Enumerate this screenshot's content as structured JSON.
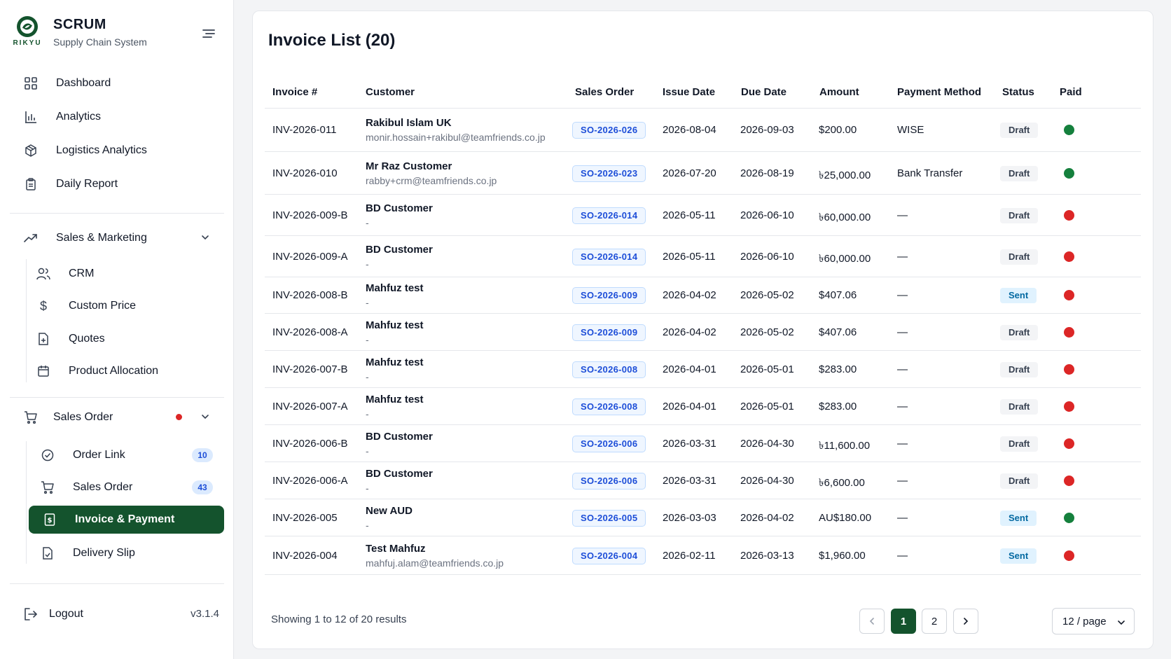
{
  "brand": {
    "logo_text": "RIKYU",
    "title": "SCRUM",
    "subtitle": "Supply Chain System"
  },
  "nav": {
    "dashboard": "Dashboard",
    "analytics": "Analytics",
    "logistics": "Logistics Analytics",
    "daily_report": "Daily Report",
    "sales_marketing": "Sales & Marketing",
    "crm": "CRM",
    "custom_price": "Custom Price",
    "quotes": "Quotes",
    "product_allocation": "Product Allocation",
    "sales_order_group": "Sales Order",
    "order_link": "Order Link",
    "order_link_count": "10",
    "sales_order": "Sales Order",
    "sales_order_count": "43",
    "invoice_payment": "Invoice & Payment",
    "delivery_slip": "Delivery Slip",
    "logout": "Logout",
    "version": "v3.1.4"
  },
  "main": {
    "title": "Invoice List (20)",
    "columns": {
      "invoice": "Invoice #",
      "customer": "Customer",
      "sales_order": "Sales Order",
      "issue_date": "Issue Date",
      "due_date": "Due Date",
      "amount": "Amount",
      "payment_method": "Payment Method",
      "status": "Status",
      "paid": "Paid"
    },
    "rows": [
      {
        "invoice": "INV-2026-011",
        "customer": "Rakibul Islam UK",
        "email": "monir.hossain+rakibul@teamfriends.co.jp",
        "so": "SO-2026-026",
        "issue": "2026-08-04",
        "due": "2026-09-03",
        "amount": "$200.00",
        "method": "WISE",
        "status": "Draft",
        "paid": true
      },
      {
        "invoice": "INV-2026-010",
        "customer": "Mr Raz Customer",
        "email": "rabby+crm@teamfriends.co.jp",
        "so": "SO-2026-023",
        "issue": "2026-07-20",
        "due": "2026-08-19",
        "amount": "৳25,000.00",
        "method": "Bank Transfer",
        "status": "Draft",
        "paid": true
      },
      {
        "invoice": "INV-2026-009-B",
        "customer": "BD Customer",
        "email": "-",
        "so": "SO-2026-014",
        "issue": "2026-05-11",
        "due": "2026-06-10",
        "amount": "৳60,000.00",
        "method": "—",
        "status": "Draft",
        "paid": false
      },
      {
        "invoice": "INV-2026-009-A",
        "customer": "BD Customer",
        "email": "-",
        "so": "SO-2026-014",
        "issue": "2026-05-11",
        "due": "2026-06-10",
        "amount": "৳60,000.00",
        "method": "—",
        "status": "Draft",
        "paid": false
      },
      {
        "invoice": "INV-2026-008-B",
        "customer": "Mahfuz test",
        "email": "-",
        "so": "SO-2026-009",
        "issue": "2026-04-02",
        "due": "2026-05-02",
        "amount": "$407.06",
        "method": "—",
        "status": "Sent",
        "paid": false
      },
      {
        "invoice": "INV-2026-008-A",
        "customer": "Mahfuz test",
        "email": "-",
        "so": "SO-2026-009",
        "issue": "2026-04-02",
        "due": "2026-05-02",
        "amount": "$407.06",
        "method": "—",
        "status": "Draft",
        "paid": false
      },
      {
        "invoice": "INV-2026-007-B",
        "customer": "Mahfuz test",
        "email": "-",
        "so": "SO-2026-008",
        "issue": "2026-04-01",
        "due": "2026-05-01",
        "amount": "$283.00",
        "method": "—",
        "status": "Draft",
        "paid": false
      },
      {
        "invoice": "INV-2026-007-A",
        "customer": "Mahfuz test",
        "email": "-",
        "so": "SO-2026-008",
        "issue": "2026-04-01",
        "due": "2026-05-01",
        "amount": "$283.00",
        "method": "—",
        "status": "Draft",
        "paid": false
      },
      {
        "invoice": "INV-2026-006-B",
        "customer": "BD Customer",
        "email": "-",
        "so": "SO-2026-006",
        "issue": "2026-03-31",
        "due": "2026-04-30",
        "amount": "৳11,600.00",
        "method": "—",
        "status": "Draft",
        "paid": false
      },
      {
        "invoice": "INV-2026-006-A",
        "customer": "BD Customer",
        "email": "-",
        "so": "SO-2026-006",
        "issue": "2026-03-31",
        "due": "2026-04-30",
        "amount": "৳6,600.00",
        "method": "—",
        "status": "Draft",
        "paid": false
      },
      {
        "invoice": "INV-2026-005",
        "customer": "New AUD",
        "email": "-",
        "so": "SO-2026-005",
        "issue": "2026-03-03",
        "due": "2026-04-02",
        "amount": "AU$180.00",
        "method": "—",
        "status": "Sent",
        "paid": true
      },
      {
        "invoice": "INV-2026-004",
        "customer": "Test Mahfuz",
        "email": "mahfuj.alam@teamfriends.co.jp",
        "so": "SO-2026-004",
        "issue": "2026-02-11",
        "due": "2026-03-13",
        "amount": "$1,960.00",
        "method": "—",
        "status": "Sent",
        "paid": false
      }
    ],
    "showing": "Showing 1 to 12 of 20 results",
    "pages": [
      "1",
      "2"
    ],
    "page_size": "12 / page"
  },
  "colors": {
    "brand_green": "#14532d",
    "paid_green": "#15803d",
    "unpaid_red": "#dc2626"
  }
}
